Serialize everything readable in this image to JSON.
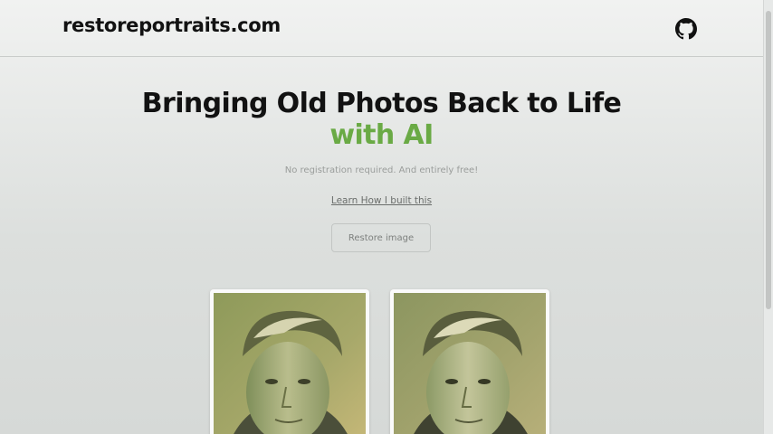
{
  "header": {
    "brand": "restoreportraits.com",
    "github_icon": "github-icon"
  },
  "hero": {
    "title_line1": "Bringing Old Photos Back to Life",
    "title_line2": "with AI",
    "subtitle": "No registration required. And entirely free!",
    "learn_link": "Learn How I built this",
    "button_label": "Restore image"
  },
  "colors": {
    "accent_green": "#6aaa45",
    "title": "#121212",
    "background": "#e3e5e4"
  },
  "photos": {
    "original": "original-portrait",
    "restored": "restored-portrait"
  }
}
